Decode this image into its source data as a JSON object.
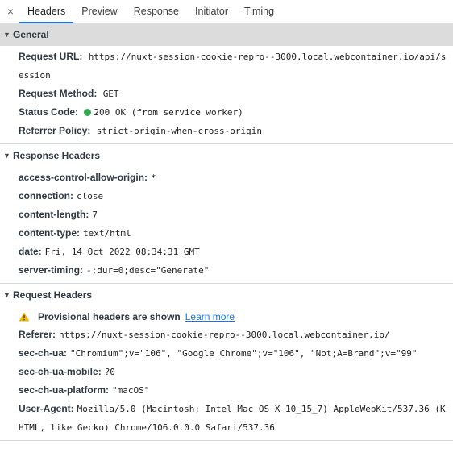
{
  "tabs": {
    "close": "×",
    "items": [
      "Headers",
      "Preview",
      "Response",
      "Initiator",
      "Timing"
    ]
  },
  "general": {
    "title": "General",
    "request_url_key": "Request URL:",
    "request_url_value": "https://nuxt-session-cookie-repro--3000.local.webcontainer.io/api/session",
    "request_method_key": "Request Method:",
    "request_method_value": "GET",
    "status_code_key": "Status Code:",
    "status_code_value": "200 OK (from service worker)",
    "referrer_policy_key": "Referrer Policy:",
    "referrer_policy_value": "strict-origin-when-cross-origin"
  },
  "response_headers": {
    "title": "Response Headers",
    "rows": [
      {
        "k": "access-control-allow-origin:",
        "v": "*"
      },
      {
        "k": "connection:",
        "v": "close"
      },
      {
        "k": "content-length:",
        "v": "7"
      },
      {
        "k": "content-type:",
        "v": "text/html"
      },
      {
        "k": "date:",
        "v": "Fri, 14 Oct 2022 08:34:31 GMT"
      },
      {
        "k": "server-timing:",
        "v": "-;dur=0;desc=\"Generate\""
      }
    ]
  },
  "request_headers": {
    "title": "Request Headers",
    "warning": "Provisional headers are shown",
    "learn_more": "Learn more",
    "rows": [
      {
        "k": "Referer:",
        "v": "https://nuxt-session-cookie-repro--3000.local.webcontainer.io/"
      },
      {
        "k": "sec-ch-ua:",
        "v": "\"Chromium\";v=\"106\", \"Google Chrome\";v=\"106\", \"Not;A=Brand\";v=\"99\""
      },
      {
        "k": "sec-ch-ua-mobile:",
        "v": "?0"
      },
      {
        "k": "sec-ch-ua-platform:",
        "v": "\"macOS\""
      },
      {
        "k": "User-Agent:",
        "v": "Mozilla/5.0 (Macintosh; Intel Mac OS X 10_15_7) AppleWebKit/537.36 (KHTML, like Gecko) Chrome/106.0.0.0 Safari/537.36"
      }
    ]
  },
  "colors": {
    "accent": "#1a73e8",
    "status_ok": "#34a853",
    "warning": "#f2b600"
  }
}
